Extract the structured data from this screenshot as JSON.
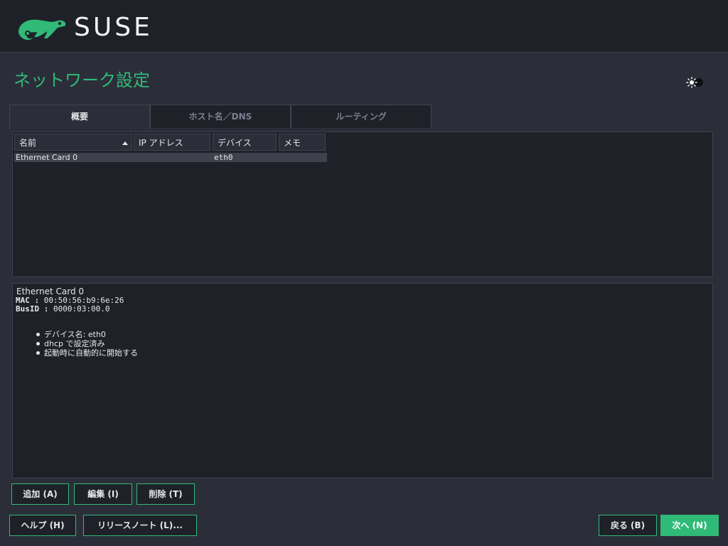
{
  "brand": {
    "name": "SUSE",
    "color": "#30ba78"
  },
  "page": {
    "title": "ネットワーク設定"
  },
  "theme_toggle": {
    "icon": "sun-moon-icon"
  },
  "tabs": [
    {
      "label": "概要",
      "active": true
    },
    {
      "label": "ホスト名／DNS",
      "active": false
    },
    {
      "label": "ルーティング",
      "active": false
    }
  ],
  "table": {
    "columns": [
      "名前",
      "IP アドレス",
      "デバイス",
      "メモ"
    ],
    "sort_column": "名前",
    "rows": [
      {
        "name": "Ethernet Card 0",
        "ip": "",
        "device": "eth0",
        "note": ""
      }
    ]
  },
  "details": {
    "title": "Ethernet Card 0",
    "mac_label": "MAC :",
    "mac_value": "00:50:56:b9:6e:26",
    "busid_label": "BusID :",
    "busid_value": "0000:03:00.0",
    "bullets": [
      "デバイス名: eth0",
      "dhcp で設定済み",
      "起動時に自動的に開始する"
    ]
  },
  "buttons": {
    "add": "追加 (A)",
    "edit": "編集 (I)",
    "delete": "削除 (T)",
    "help": "ヘルプ (H)",
    "release_notes": "リリースノート (L)...",
    "back": "戻る (B)",
    "next": "次へ (N)"
  }
}
